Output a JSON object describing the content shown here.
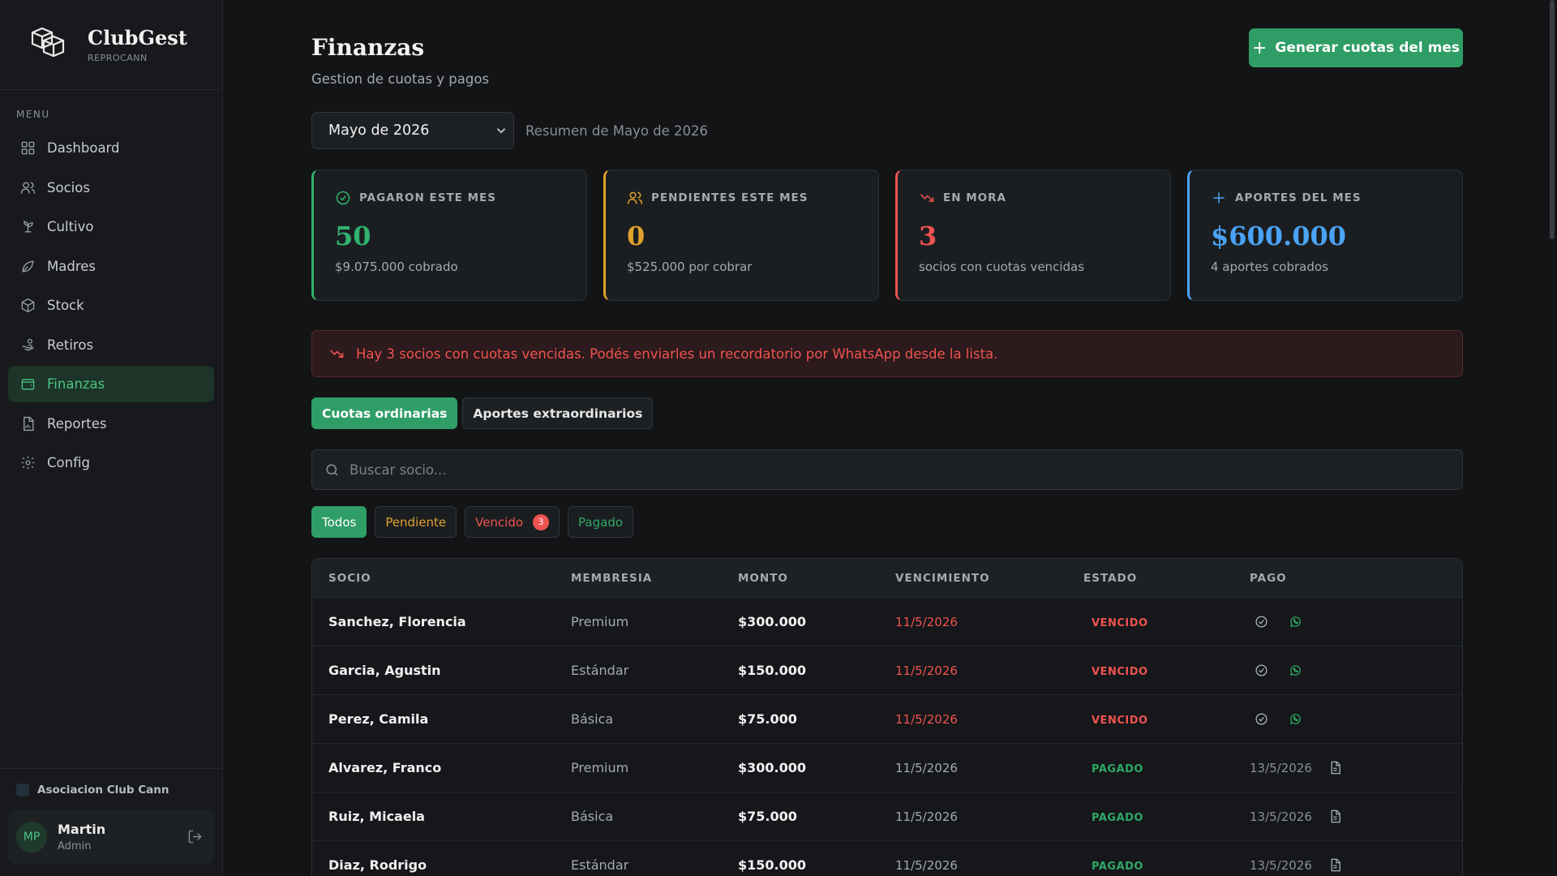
{
  "brand": {
    "name": "ClubGest",
    "sub": "REPROCANN"
  },
  "menu_title": "MENU",
  "nav": [
    {
      "label": "Dashboard",
      "icon": "grid-icon",
      "active": false
    },
    {
      "label": "Socios",
      "icon": "users-icon",
      "active": false
    },
    {
      "label": "Cultivo",
      "icon": "sprout-icon",
      "active": false
    },
    {
      "label": "Madres",
      "icon": "leaf-icon",
      "active": false
    },
    {
      "label": "Stock",
      "icon": "box-icon",
      "active": false
    },
    {
      "label": "Retiros",
      "icon": "hand-icon",
      "active": false
    },
    {
      "label": "Finanzas",
      "icon": "wallet-icon",
      "active": true
    },
    {
      "label": "Reportes",
      "icon": "file-chart-icon",
      "active": false
    },
    {
      "label": "Config",
      "icon": "gear-icon",
      "active": false
    }
  ],
  "org": "Asociacion Club Cann",
  "user": {
    "initials": "MP",
    "name": "Martin",
    "role": "Admin"
  },
  "page": {
    "title": "Finanzas",
    "subtitle": "Gestion de cuotas y pagos",
    "generate_button": "Generar cuotas del mes",
    "period_select": "Mayo de 2026",
    "period_summary": "Resumen de Mayo de 2026"
  },
  "stats": [
    {
      "label": "PAGARON ESTE MES",
      "value": "50",
      "sub": "$9.075.000 cobrado",
      "color": "#2fb36d",
      "icon": "check-circle-icon"
    },
    {
      "label": "PENDIENTES ESTE MES",
      "value": "0",
      "sub": "$525.000 por cobrar",
      "color": "#e0a12c",
      "icon": "users-icon"
    },
    {
      "label": "EN MORA",
      "value": "3",
      "sub": "socios con cuotas vencidas",
      "color": "#ef5350",
      "icon": "trending-down-icon"
    },
    {
      "label": "APORTES DEL MES",
      "value": "$600.000",
      "sub": "4 aportes cobrados",
      "color": "#4aa3f5",
      "icon": "plus-icon"
    }
  ],
  "alert": "Hay 3 socios con cuotas vencidas. Podés enviarles un recordatorio por WhatsApp desde la lista.",
  "tabs": [
    {
      "label": "Cuotas ordinarias",
      "active": true
    },
    {
      "label": "Aportes extraordinarios",
      "active": false
    }
  ],
  "search": {
    "placeholder": "Buscar socio..."
  },
  "filters": [
    {
      "label": "Todos",
      "color": "#ffffff",
      "active": true,
      "count": ""
    },
    {
      "label": "Pendiente",
      "color": "#e0a12c",
      "active": false,
      "count": ""
    },
    {
      "label": "Vencido",
      "color": "#ef5350",
      "active": false,
      "count": "3"
    },
    {
      "label": "Pagado",
      "color": "#2fa865",
      "active": false,
      "count": ""
    }
  ],
  "table": {
    "headers": [
      "SOCIO",
      "MEMBRESIA",
      "MONTO",
      "VENCIMIENTO",
      "ESTADO",
      "PAGO"
    ],
    "rows": [
      {
        "socio": "Sanchez, Florencia",
        "membresia": "Premium",
        "monto": "$300.000",
        "vencimiento": "11/5/2026",
        "estado": "VENCIDO",
        "pago": ""
      },
      {
        "socio": "Garcia, Agustin",
        "membresia": "Estándar",
        "monto": "$150.000",
        "vencimiento": "11/5/2026",
        "estado": "VENCIDO",
        "pago": ""
      },
      {
        "socio": "Perez, Camila",
        "membresia": "Básica",
        "monto": "$75.000",
        "vencimiento": "11/5/2026",
        "estado": "VENCIDO",
        "pago": ""
      },
      {
        "socio": "Alvarez, Franco",
        "membresia": "Premium",
        "monto": "$300.000",
        "vencimiento": "11/5/2026",
        "estado": "PAGADO",
        "pago": "13/5/2026"
      },
      {
        "socio": "Ruiz, Micaela",
        "membresia": "Básica",
        "monto": "$75.000",
        "vencimiento": "11/5/2026",
        "estado": "PAGADO",
        "pago": "13/5/2026"
      },
      {
        "socio": "Diaz, Rodrigo",
        "membresia": "Estándar",
        "monto": "$150.000",
        "vencimiento": "11/5/2026",
        "estado": "PAGADO",
        "pago": "13/5/2026"
      }
    ]
  }
}
